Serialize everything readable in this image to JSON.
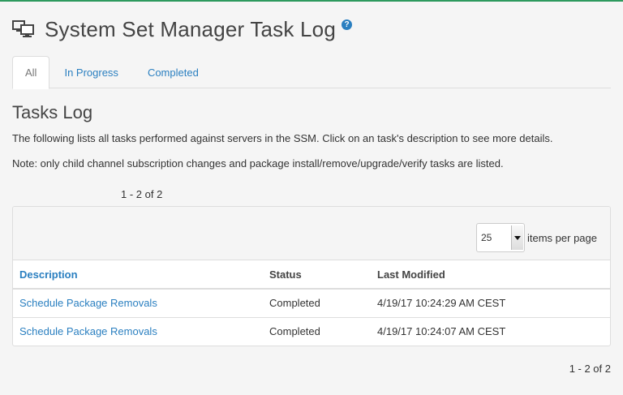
{
  "header": {
    "title": "System Set Manager Task Log",
    "icon": "system-set-icon",
    "help_icon": "help-icon",
    "help_glyph": "?"
  },
  "tabs": [
    {
      "label": "All",
      "active": true
    },
    {
      "label": "In Progress",
      "active": false
    },
    {
      "label": "Completed",
      "active": false
    }
  ],
  "main": {
    "section_title": "Tasks Log",
    "description": "The following lists all tasks performed against servers in the SSM. Click on an task's description to see more details.",
    "note": "Note: only child channel subscription changes and package install/remove/upgrade/verify tasks are listed.",
    "pager_top": "1 - 2 of 2",
    "pager_bottom": "1 - 2 of 2",
    "per_page": {
      "value": "25",
      "label": "items per page"
    }
  },
  "table": {
    "columns": [
      "Description",
      "Status",
      "Last Modified"
    ],
    "rows": [
      {
        "description": "Schedule Package Removals",
        "status": "Completed",
        "modified": "4/19/17 10:24:29 AM CEST"
      },
      {
        "description": "Schedule Package Removals",
        "status": "Completed",
        "modified": "4/19/17 10:24:07 AM CEST"
      }
    ]
  },
  "colors": {
    "accent": "#2a7fc0",
    "top_border": "#2e9a5e"
  }
}
